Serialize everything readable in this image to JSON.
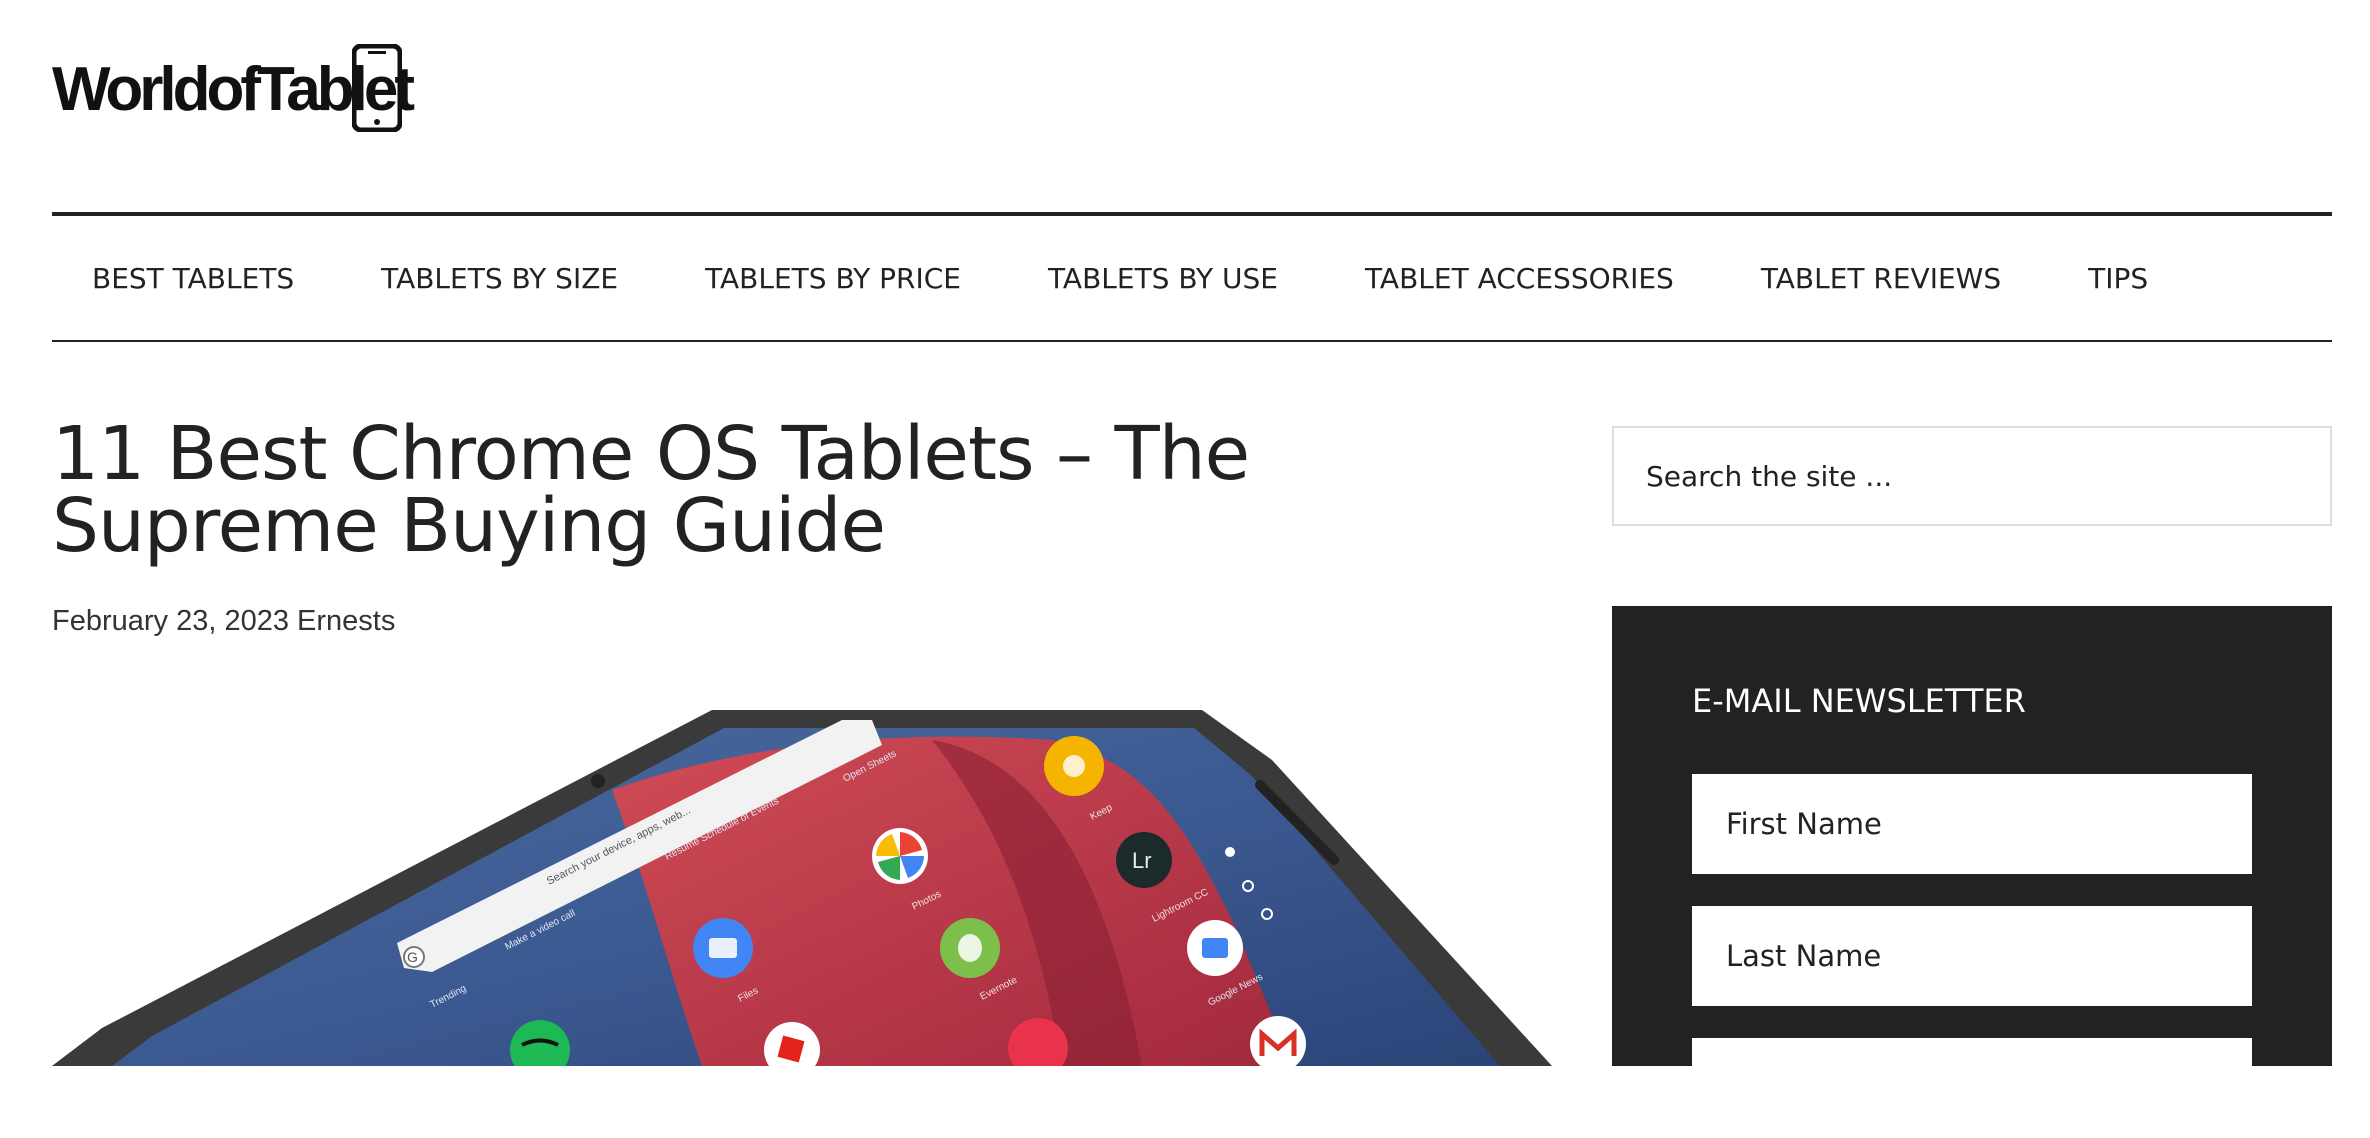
{
  "site": {
    "logo_text_prefix": "World of Tab",
    "logo_text_suffix": "let",
    "logo_full": "WorldofTablet"
  },
  "nav": {
    "items": [
      {
        "label": "BEST TABLETS"
      },
      {
        "label": "TABLETS BY SIZE"
      },
      {
        "label": "TABLETS BY PRICE"
      },
      {
        "label": "TABLETS BY USE"
      },
      {
        "label": "TABLET ACCESSORIES"
      },
      {
        "label": "TABLET REVIEWS"
      },
      {
        "label": "TIPS"
      }
    ]
  },
  "article": {
    "title": "11 Best Chrome OS Tablets – The Supreme Buying Guide",
    "date": "February 23, 2023",
    "author": "Ernests"
  },
  "hero": {
    "search_placeholder": "Search your device, apps, web...",
    "suggestions": [
      "Make a video call",
      "Resume Schedule of Events",
      "Open Sheets",
      "Trending"
    ],
    "apps": [
      "Keep",
      "Lightroom CC",
      "Photos",
      "Files",
      "Evernote",
      "Google News"
    ]
  },
  "sidebar": {
    "search": {
      "placeholder": "Search the site ..."
    },
    "newsletter": {
      "heading": "E-MAIL NEWSLETTER",
      "first_name_placeholder": "First Name",
      "last_name_placeholder": "Last Name"
    }
  },
  "colors": {
    "text": "#222222",
    "newsletter_bg": "#222222",
    "input_border": "#dddddd",
    "hero_red": "#c8323f",
    "hero_blue": "#2f4f8a"
  }
}
